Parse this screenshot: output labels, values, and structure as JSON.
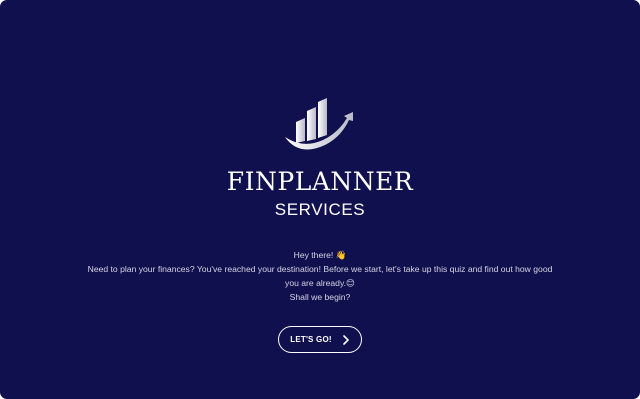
{
  "brand": {
    "name": "FINPLANNER",
    "subtitle": "SERVICES"
  },
  "intro": {
    "greeting": "Hey there! 👋",
    "line1": "Need to plan your finances? You've reached your destination! Before we start, let's take up this quiz and find out how good",
    "line2": "you are already.😊",
    "line3": "Shall we begin?"
  },
  "cta": {
    "label": "LET'S GO!",
    "icon": "chevron-right-icon"
  },
  "colors": {
    "background": "#11104e",
    "text": "#ffffff",
    "body_text": "#d4d4e4"
  }
}
